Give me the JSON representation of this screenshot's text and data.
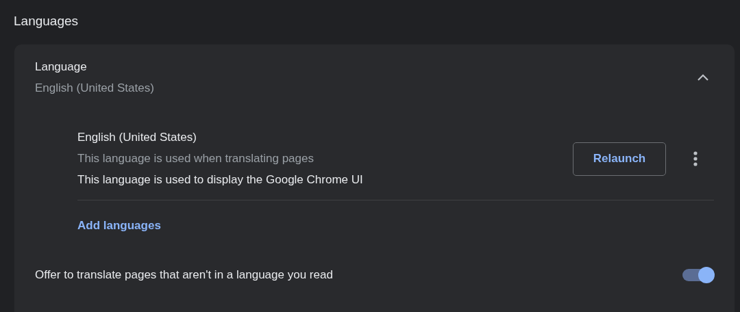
{
  "section_title": "Languages",
  "language_panel": {
    "title": "Language",
    "value": "English (United States)",
    "expanded": true,
    "languages": [
      {
        "name": "English (United States)",
        "notes": [
          {
            "text": "This language is used when translating pages",
            "kind": "secondary"
          },
          {
            "text": "This language is used to display the Google Chrome UI",
            "kind": "primary"
          }
        ],
        "action": "Relaunch"
      }
    ],
    "add_link": "Add languages"
  },
  "translate_offer": {
    "label": "Offer to translate pages that aren't in a language you read",
    "on": true
  }
}
